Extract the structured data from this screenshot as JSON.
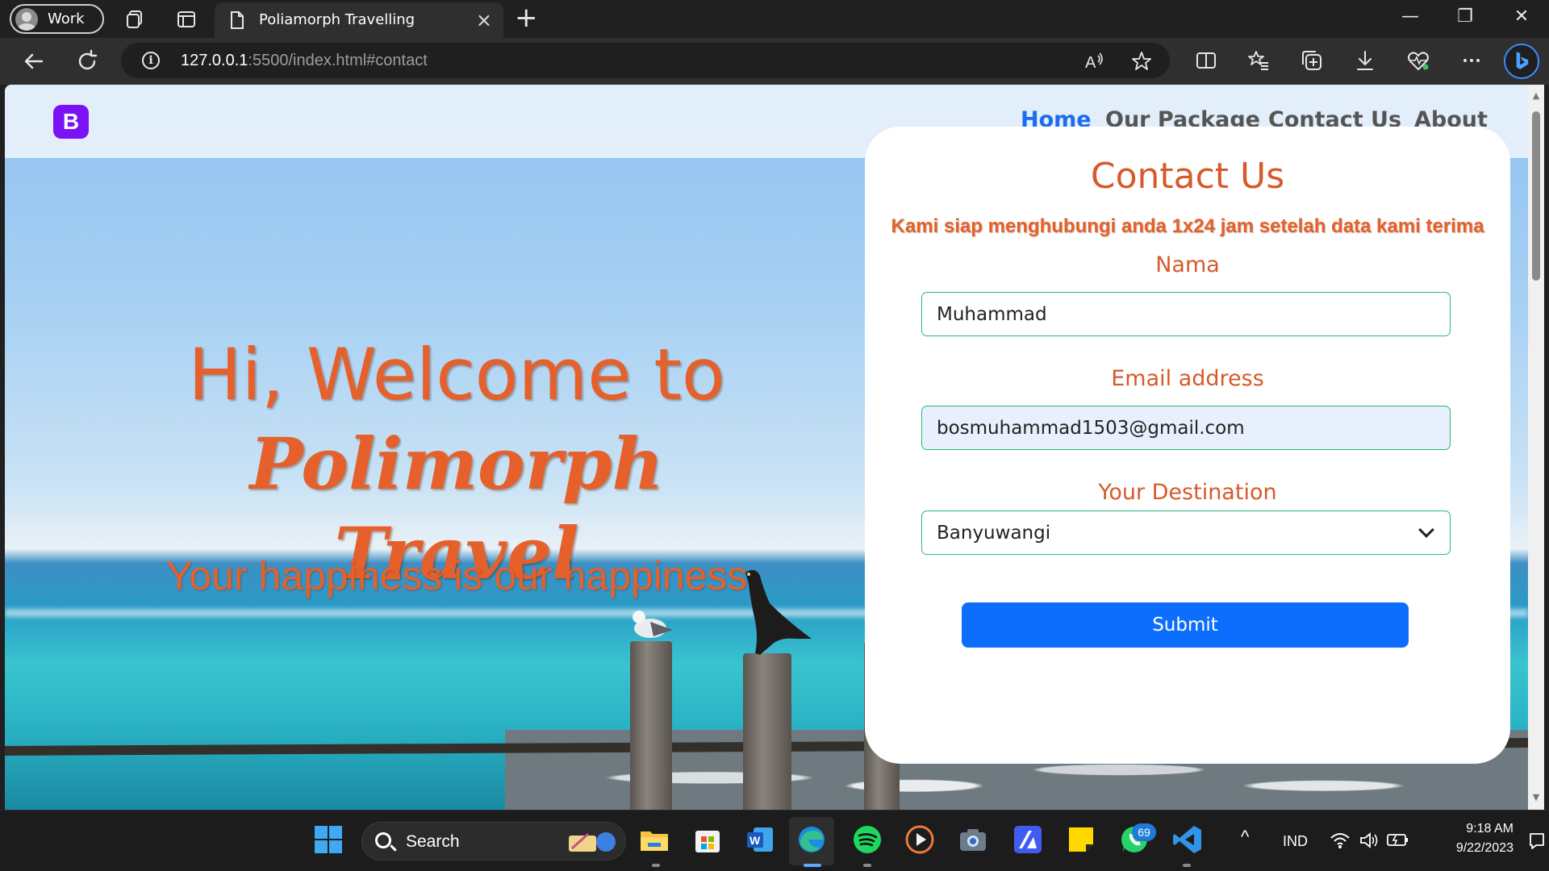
{
  "browser": {
    "profile_label": "Work",
    "tab_title": "Poliamorph Travelling",
    "tab_close": "×",
    "new_tab": "+",
    "window_controls": {
      "minimize": "—",
      "restore": "❐",
      "close": "✕"
    },
    "url_host": "127.0.0.1",
    "url_rest": ":5500/index.html#contact",
    "info_glyph": "i",
    "read_aloud_glyph": "A"
  },
  "site": {
    "brand_letter": "B",
    "brand_color": "#7a12f5",
    "nav": {
      "home": "Home",
      "package": "Our Package",
      "contact": "Contact Us",
      "about": "About"
    },
    "hero": {
      "title_plain": "Hi, Welcome to ",
      "title_script_1": "Polimorph",
      "title_script_2": "Travel",
      "subtitle": "Your happiness is our happiness"
    },
    "contact": {
      "title": "Contact Us",
      "note": "Kami siap menghubungi anda 1x24 jam setelah data kami terima",
      "name_label": "Nama",
      "name_value": "Muhammad",
      "email_label": "Email address",
      "email_value": "bosmuhammad1503@gmail.com",
      "destination_label": "Your Destination",
      "destination_value": "Banyuwangi",
      "submit_label": "Submit"
    },
    "accent_color": "#e5602a"
  },
  "taskbar": {
    "search_label": "Search",
    "whatsapp_badge": "69",
    "language": "IND",
    "time": "9:18 AM",
    "date": "9/22/2023",
    "chevron_up": "^"
  }
}
